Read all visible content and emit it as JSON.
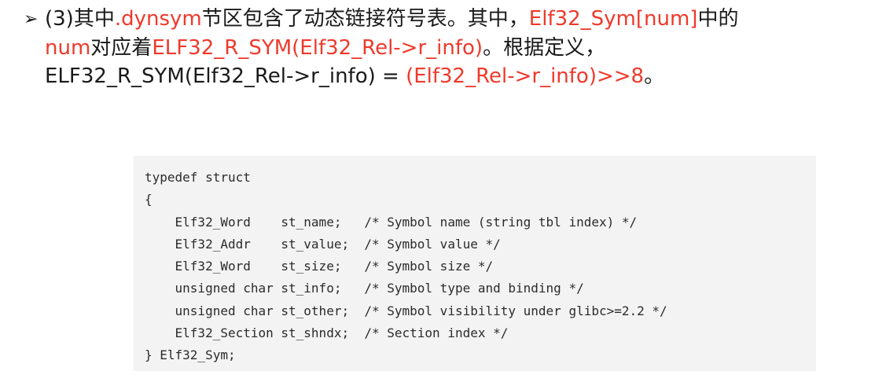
{
  "bullet": {
    "marker": "➢",
    "line1": {
      "t1": "(3)其中",
      "r1": ".dynsym",
      "t2": "节区包含了动态链接符号表。其中，",
      "r2": "Elf32_Sym[num]",
      "t3": "中的"
    },
    "line2": {
      "r1": "num",
      "t1": "对应着",
      "r2": "ELF32_R_SYM(Elf32_Rel->r_info)",
      "t2": "。根据定义，"
    },
    "line3": {
      "t1": "ELF32_R_SYM(Elf32_Rel->r_info) = ",
      "r1": "(Elf32_Rel->r_info)>>8",
      "t2": "。"
    }
  },
  "code": {
    "lines": [
      "typedef struct",
      "{",
      "    Elf32_Word    st_name;   /* Symbol name (string tbl index) */",
      "    Elf32_Addr    st_value;  /* Symbol value */",
      "    Elf32_Word    st_size;   /* Symbol size */",
      "    unsigned char st_info;   /* Symbol type and binding */",
      "    unsigned char st_other;  /* Symbol visibility under glibc>=2.2 */",
      "    Elf32_Section st_shndx;  /* Section index */",
      "} Elf32_Sym;"
    ]
  }
}
